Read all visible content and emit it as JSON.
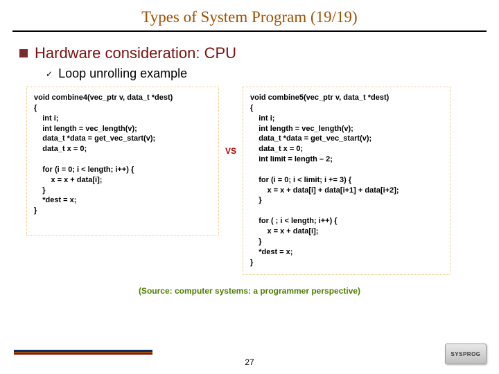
{
  "title": "Types of System Program (19/19)",
  "main_bullet": "Hardware consideration: CPU",
  "sub_bullet": "Loop unrolling example",
  "code_left": "void combine4(vec_ptr v, data_t *dest)\n{\n    int i;\n    int length = vec_length(v);\n    data_t *data = get_vec_start(v);\n    data_t x = 0;\n\n    for (i = 0; i < length; i++) {\n        x = x + data[i];\n    }\n    *dest = x;\n}",
  "vs_label": "VS",
  "code_right": "void combine5(vec_ptr v, data_t *dest)\n{\n    int i;\n    int length = vec_length(v);\n    data_t *data = get_vec_start(v);\n    data_t x = 0;\n    int limit = length – 2;\n\n    for (i = 0; i < limit; i += 3) {\n        x = x + data[i] + data[i+1] + data[i+2];\n    }\n\n    for ( ; i < length; i++) {\n        x = x + data[i];\n    }\n    *dest = x;\n}",
  "source_note": "(Source: computer systems: a programmer perspective)",
  "page_number": "27",
  "logo_text": "SYSPROG"
}
